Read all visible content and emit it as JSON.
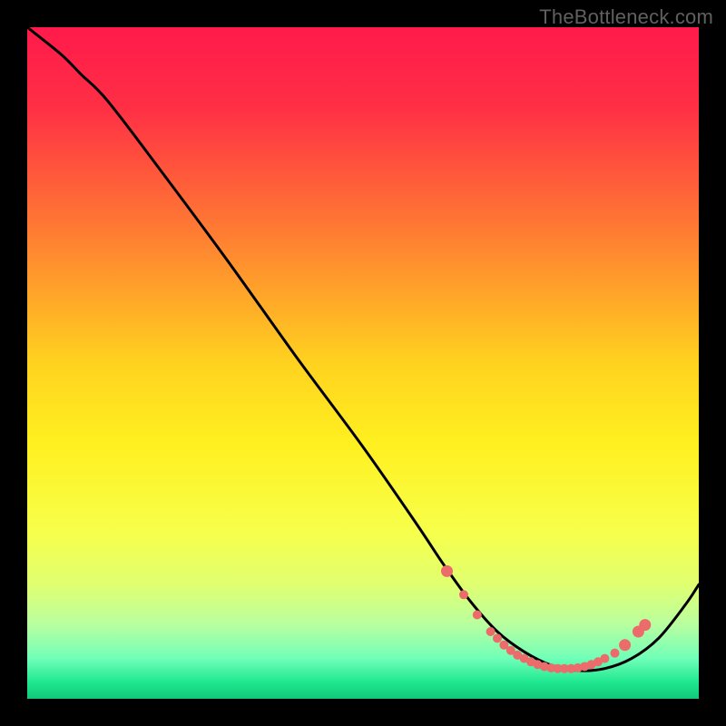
{
  "attribution": "TheBottleneck.com",
  "gradient_stops": [
    {
      "offset": 0,
      "color": "#ff1a4b"
    },
    {
      "offset": 0.12,
      "color": "#ff2f45"
    },
    {
      "offset": 0.3,
      "color": "#ff7a33"
    },
    {
      "offset": 0.5,
      "color": "#ffd21f"
    },
    {
      "offset": 0.62,
      "color": "#fff020"
    },
    {
      "offset": 0.75,
      "color": "#f7ff4a"
    },
    {
      "offset": 0.83,
      "color": "#e0ff70"
    },
    {
      "offset": 0.89,
      "color": "#b8ffa0"
    },
    {
      "offset": 0.94,
      "color": "#70ffb8"
    },
    {
      "offset": 0.975,
      "color": "#20e890"
    },
    {
      "offset": 1.0,
      "color": "#10c878"
    }
  ],
  "chart_data": {
    "type": "line",
    "title": "",
    "xlabel": "",
    "ylabel": "",
    "xlim": [
      0,
      100
    ],
    "ylim": [
      0,
      100
    ],
    "series": [
      {
        "name": "curve",
        "x": [
          0,
          5,
          8,
          12,
          20,
          30,
          40,
          50,
          58,
          62,
          66,
          70,
          74,
          78,
          82,
          86,
          90,
          94,
          98,
          100
        ],
        "y": [
          100,
          96,
          93,
          89,
          78.5,
          65,
          51,
          37.5,
          26,
          20,
          14.5,
          10,
          7,
          5,
          4.2,
          4.5,
          6,
          9,
          14,
          17
        ]
      }
    ],
    "markers": {
      "name": "trough-dots",
      "color": "#ec6b6b",
      "x": [
        62.5,
        65,
        67,
        69,
        70,
        71,
        72,
        73,
        74,
        75,
        76,
        77,
        78,
        79,
        80,
        81,
        82,
        83,
        84,
        85,
        86,
        87.5,
        89,
        91,
        92
      ],
      "y": [
        19,
        15.5,
        12.5,
        10,
        9,
        8,
        7.2,
        6.5,
        6,
        5.5,
        5.1,
        4.8,
        4.6,
        4.5,
        4.5,
        4.5,
        4.6,
        4.8,
        5.1,
        5.5,
        6,
        6.8,
        8,
        10,
        11
      ]
    }
  }
}
